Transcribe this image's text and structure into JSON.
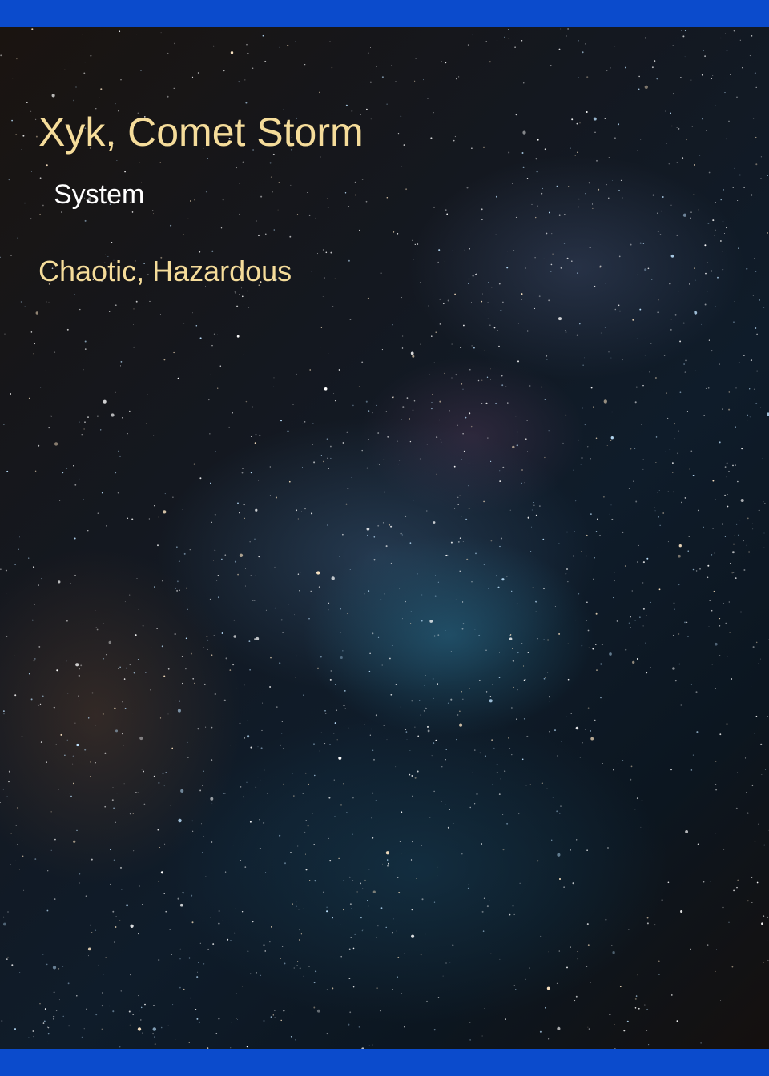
{
  "card": {
    "title": "Xyk, Comet Storm",
    "type": "System",
    "traits": "Chaotic, Hazardous"
  },
  "colors": {
    "frame_bar": "#0b4bcc",
    "title_text": "#f5dc9a",
    "type_text": "#ffffff",
    "traits_text": "#f5dc9a"
  },
  "background": {
    "subject": "starfield-milky-way"
  }
}
